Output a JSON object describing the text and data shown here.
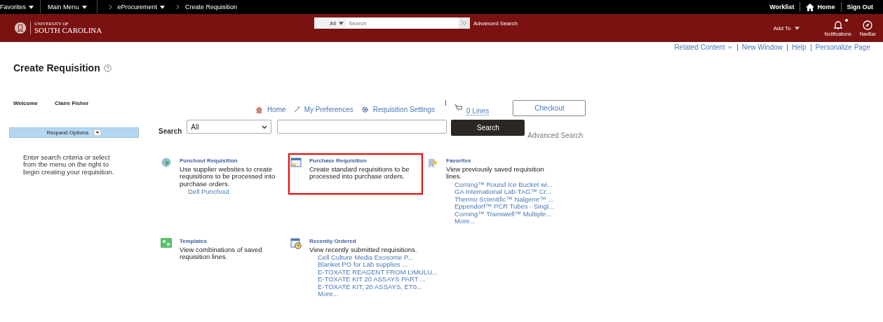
{
  "top_bar": {
    "menus": [
      {
        "label": "Favorites"
      },
      {
        "label": "Main Menu"
      }
    ],
    "breadcrumbs": [
      {
        "label": "eProcurement",
        "dropdown": true
      },
      {
        "label": "Create Requisition",
        "dropdown": false
      }
    ],
    "right_links": [
      {
        "label": "Worklist",
        "kind": "text"
      },
      {
        "label": "Home",
        "kind": "home"
      },
      {
        "label": "Sign Out",
        "kind": "text"
      }
    ]
  },
  "header": {
    "logo_small": "UNIVERSITY OF",
    "logo_large": "SOUTH CAROLINA",
    "search_scope": "All",
    "search_placeholder": "Search",
    "advanced_search": "Advanced Search",
    "add_to": "Add To",
    "notifications": {
      "label": "Notifications",
      "unread": true
    },
    "navbar": "NavBar"
  },
  "page_links": [
    {
      "label": "Related Content",
      "menu": true
    },
    {
      "label": "New Window",
      "menu": false
    },
    {
      "label": "Help",
      "menu": false
    },
    {
      "label": "Personalize Page",
      "menu": false
    }
  ],
  "title": "Create Requisition",
  "welcome": {
    "label": "Welcome",
    "name": "Claire Fisher"
  },
  "request_options": "Request Options",
  "help_text": "Enter search criteria or select from the menu on the right to begin creating your requisition.",
  "nav": [
    {
      "label": "Home",
      "kind": "home"
    },
    {
      "label": "My Preferences",
      "kind": "wand"
    },
    {
      "label": "Requisition Settings",
      "kind": "gear"
    }
  ],
  "cart": {
    "label": "0 Lines"
  },
  "checkout": "Checkout",
  "search": {
    "label": "Search",
    "scope": "All",
    "button": "Search",
    "advanced": "Advanced Search"
  },
  "tiles": [
    {
      "kind": "globe",
      "title": "Punchout Requisition",
      "description": "Use supplier websites to create requisitions to be processed into purchase orders.",
      "highlighted": false,
      "links": [
        "Dell Punchout"
      ]
    },
    {
      "kind": "window",
      "title": "Purchase Requisition",
      "description": "Create standard requisitions to be processed into purchase orders.",
      "highlighted": true
    },
    {
      "kind": "star",
      "title": "Favorites",
      "description": "View previously saved requisition lines.",
      "highlighted": false,
      "links": [
        "Corning™ Round Ice Bucket wi...",
        "GA International Lab-TAG™ Cr...",
        "Thermo Scientific™ Nalgene™ ...",
        "Eppendorf™ PCR Tubes - Singl...",
        "Corning™ Transwell™ Multiple...",
        "More..."
      ]
    },
    {
      "kind": "template",
      "title": "Templates",
      "description": "View combinations of saved requisition lines.",
      "highlighted": false
    },
    {
      "kind": "clock",
      "title": "Recently Ordered",
      "description": "View recently submitted requisitions.",
      "highlighted": false,
      "links": [
        "Cell Culture Media Exosome P...",
        "Blanket PO for Lab supplies ...",
        "E-TOXATE REAGENT FROM LIMULU...",
        "E-TOXATE KIT 20 ASSAYS PART ...",
        "E-TOXATE KIT, 20 ASSAYS, ET0...",
        "More..."
      ]
    }
  ]
}
